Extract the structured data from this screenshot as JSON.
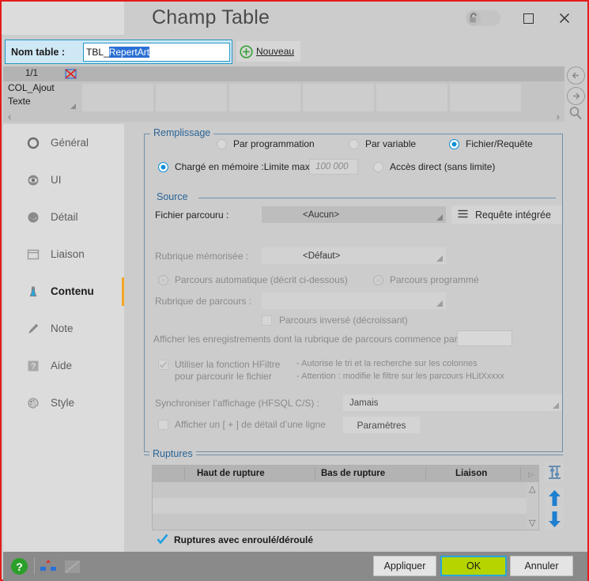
{
  "window": {
    "title": "Champ Table",
    "lock_icon": "lock-open-icon",
    "maximize_icon": "maximize-icon",
    "close_icon": "close-icon"
  },
  "table_name_bar": {
    "label": "Nom table :",
    "value_prefix": "TBL_",
    "value_selected": "RepertArt",
    "new_button": {
      "label": "Nouveau",
      "icon": "plus-circle-icon"
    }
  },
  "preview": {
    "count": "1/1",
    "no_image_icon": "no-image-icon",
    "column_name": "COL_Ajout",
    "column_type": "Texte",
    "scroll_left_icon": "chevron-left-icon",
    "scroll_right_icon": "chevron-right-icon"
  },
  "right_nav": {
    "back_icon": "arrow-left-circle-icon",
    "forward_icon": "arrow-right-circle-icon",
    "search_icon": "magnifier-icon"
  },
  "sidebar": {
    "items": [
      {
        "label": "Général",
        "icon": "circle-icon",
        "active": false
      },
      {
        "label": "UI",
        "icon": "eye-icon",
        "active": false
      },
      {
        "label": "Détail",
        "icon": "detail-circle-icon",
        "active": false
      },
      {
        "label": "Liaison",
        "icon": "window-icon",
        "active": false
      },
      {
        "label": "Contenu",
        "icon": "flask-icon",
        "active": true
      },
      {
        "label": "Note",
        "icon": "pencil-icon",
        "active": false
      },
      {
        "label": "Aide",
        "icon": "question-square-icon",
        "active": false
      },
      {
        "label": "Style",
        "icon": "palette-icon",
        "active": false
      }
    ]
  },
  "content": {
    "remplissage": {
      "legend": "Remplissage",
      "mode_options": [
        {
          "label": "Par programmation",
          "selected": false
        },
        {
          "label": "Par variable",
          "selected": false
        },
        {
          "label": "Fichier/Requête",
          "selected": true
        }
      ],
      "load_options": [
        {
          "label": "Chargé en mémoire :Limite max :",
          "selected": true
        },
        {
          "label": "Accès direct (sans limite)",
          "selected": false
        }
      ],
      "limit_placeholder": "100 000"
    },
    "source": {
      "legend": "Source",
      "file_label": "Fichier parcouru :",
      "file_value": "<Aucun>",
      "query_button": {
        "label": "Requête intégrée",
        "icon": "menu-burger-icon"
      },
      "memo_label": "Rubrique mémorisée :",
      "memo_value": "<Défaut>",
      "browse_options": [
        {
          "label": "Parcours automatique (décrit ci-dessous)",
          "selected": true
        },
        {
          "label": "Parcours programmé",
          "selected": false
        }
      ],
      "browse_field_label": "Rubrique de parcours :",
      "browse_field_value": "",
      "reverse_checkbox": {
        "label": "Parcours inversé (décroissant)",
        "checked": false
      },
      "startswith_label": "Afficher les enregistrements dont la rubrique de parcours commence par :",
      "startswith_value": "",
      "hfiltre_checkbox": {
        "label_line1": "Utiliser la fonction HFiltre",
        "label_line2": "pour parcourir le fichier",
        "checked": true
      },
      "hfiltre_notes": [
        "- Autorise le tri et la recherche sur les colonnes",
        "- Attention : modifie le filtre sur les parcours HLitXxxxx"
      ],
      "sync_label": "Synchroniser l’affichage (HFSQL C/S) :",
      "sync_value": "Jamais",
      "detail_checkbox": {
        "label": "Afficher un [ + ] de détail d’une ligne",
        "checked": false
      },
      "params_button": "Paramètres"
    },
    "ruptures": {
      "legend": "Ruptures",
      "columns": [
        "Haut de rupture",
        "Bas de rupture",
        "Liaison"
      ],
      "rows": [],
      "more_icon": "chevron-right-small-icon",
      "scroll_up_icon": "chevron-up-icon",
      "scroll_down_icon": "chevron-down-icon",
      "side_buttons": [
        {
          "icon": "settings-sliders-icon"
        },
        {
          "icon": "arrow-up-icon"
        },
        {
          "icon": "arrow-down-icon"
        }
      ],
      "enroule_checkbox": {
        "label": "Ruptures avec enroulé/déroulé",
        "checked": true
      }
    }
  },
  "footer": {
    "help_icon": "help-question-icon",
    "tools_icon": "diagram-icon",
    "disabled_icon": "disabled-tile-icon",
    "buttons": [
      {
        "label": "Appliquer",
        "primary": false
      },
      {
        "label": "OK",
        "primary": true
      },
      {
        "label": "Annuler",
        "primary": false
      }
    ]
  },
  "colors": {
    "accent_blue": "#0f8fd8",
    "group_border": "#6f8fa8",
    "legend_text": "#2a6496",
    "active_marker": "#f5a623",
    "ok_green": "#b5d400",
    "frame_red": "#e41b1b"
  }
}
